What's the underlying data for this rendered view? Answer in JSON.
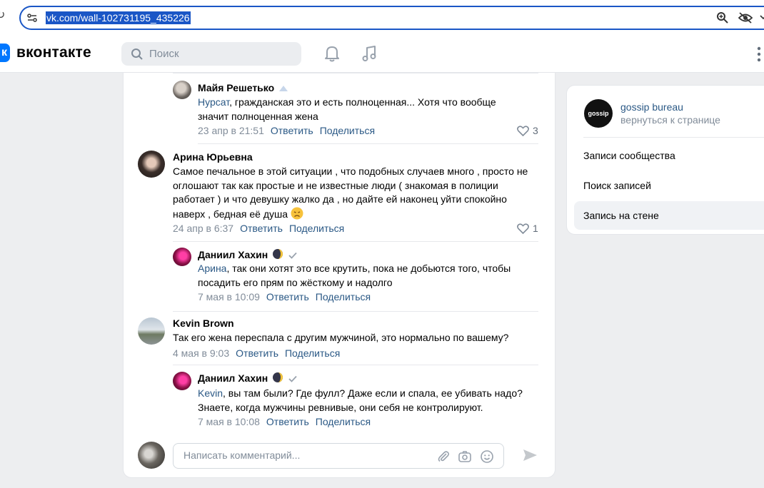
{
  "browser": {
    "url": "vk.com/wall-102731195_435226"
  },
  "header": {
    "logo_letter": "к",
    "wordmark": "вконтакте",
    "search_placeholder": "Поиск"
  },
  "comments": [
    {
      "author": "Майя Решетько",
      "mention": "Нурсат",
      "text": ", гражданская это и есть полноценная... Хотя что вообще значит полноценная жена",
      "date": "23 апр в 21:51",
      "reply": "Ответить",
      "share": "Поделиться",
      "likes": "3"
    },
    {
      "author": "Арина Юрьевна",
      "text": "Самое печальное в этой ситуации , что подобных случаев много , просто не оглошают так как простые и не известные люди ( знакомая в полиции работает ) и что девушку жалко да , но дайте ей наконец уйти спокойно наверх , бедная её душа",
      "date": "24 апр в 6:37",
      "reply": "Ответить",
      "share": "Поделиться",
      "likes": "1"
    },
    {
      "author": "Даниил Хахин",
      "mention": "Арина",
      "text": ", так они хотят это все крутить, пока не добьются того, чтобы посадить его прям по жёсткому и надолго",
      "date": "7 мая в 10:09",
      "reply": "Ответить",
      "share": "Поделиться"
    },
    {
      "author": "Kevin Brown",
      "text": "Так его жена переспала с другим мужчиной, это нормально по вашему?",
      "date": "4 мая в 9:03",
      "reply": "Ответить",
      "share": "Поделиться"
    },
    {
      "author": "Даниил Хахин",
      "mention": "Kevin",
      "text": ", вы там были? Где фулл? Даже если и спала, ее убивать надо? Знаете, когда мужчины ревнивые, они себя не контролируют.",
      "date": "7 мая в 10:08",
      "reply": "Ответить",
      "share": "Поделиться"
    }
  ],
  "comment_input": {
    "placeholder": "Написать комментарий..."
  },
  "right_panel": {
    "group_name": "gossip bureau",
    "group_logo_text": "gossip",
    "back_link": "вернуться к странице",
    "menu": [
      "Записи сообщества",
      "Поиск записей",
      "Запись на стене"
    ],
    "active_index": 2
  },
  "colors": {
    "vk_blue": "#0077ff",
    "link": "#2a5885",
    "url_highlight": "#1a56c6"
  }
}
